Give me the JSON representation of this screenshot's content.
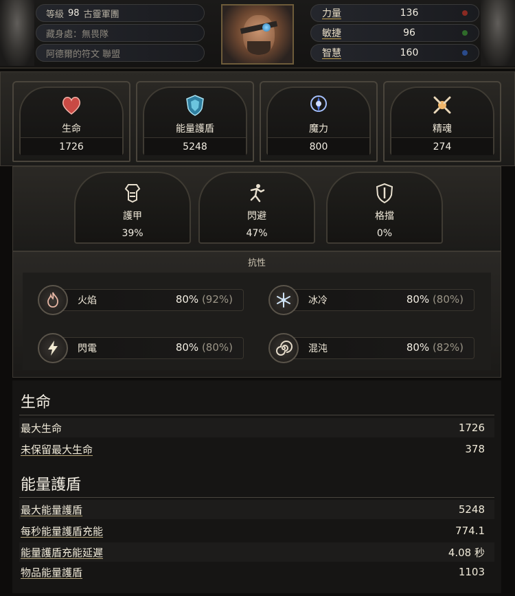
{
  "character": {
    "level_label": "等級",
    "level": "98",
    "guild": "古靈軍團",
    "hideout": "藏身處：無畏隊",
    "league": "阿德爾的符文 聯盟"
  },
  "attributes": [
    {
      "label": "力量",
      "value": "136",
      "color": "#8a2a22"
    },
    {
      "label": "敏捷",
      "value": "96",
      "color": "#2f6b2a"
    },
    {
      "label": "智慧",
      "value": "160",
      "color": "#2a4a8a"
    }
  ],
  "main_stats": [
    {
      "label": "生命",
      "value": "1726",
      "icon": "heart-icon"
    },
    {
      "label": "能量護盾",
      "value": "5248",
      "icon": "shield-icon"
    },
    {
      "label": "魔力",
      "value": "800",
      "icon": "mana-icon"
    },
    {
      "label": "精魂",
      "value": "274",
      "icon": "spirit-icon"
    }
  ],
  "defences": [
    {
      "label": "護甲",
      "value": "39%",
      "icon": "armour-icon"
    },
    {
      "label": "閃避",
      "value": "47%",
      "icon": "evasion-icon"
    },
    {
      "label": "格擋",
      "value": "0%",
      "icon": "block-icon"
    }
  ],
  "resistances": {
    "title": "抗性",
    "items": [
      {
        "label": "火焰",
        "value": "80%",
        "max": "(92%)",
        "icon": "fire-icon"
      },
      {
        "label": "冰冷",
        "value": "80%",
        "max": "(80%)",
        "icon": "cold-icon"
      },
      {
        "label": "閃電",
        "value": "80%",
        "max": "(80%)",
        "icon": "lightning-icon"
      },
      {
        "label": "混沌",
        "value": "80%",
        "max": "(82%)",
        "icon": "chaos-icon"
      }
    ]
  },
  "life_section": {
    "title": "生命",
    "rows": [
      {
        "label": "最大生命",
        "value": "1726"
      },
      {
        "label": "未保留最大生命",
        "value": "378"
      }
    ]
  },
  "es_section": {
    "title": "能量護盾",
    "rows": [
      {
        "label": "最大能量護盾",
        "value": "5248"
      },
      {
        "label": "每秒能量護盾充能",
        "value": "774.1"
      },
      {
        "label": "能量護盾充能延遲",
        "value": "4.08 秒"
      },
      {
        "label": "物品能量護盾",
        "value": "1103"
      }
    ]
  }
}
